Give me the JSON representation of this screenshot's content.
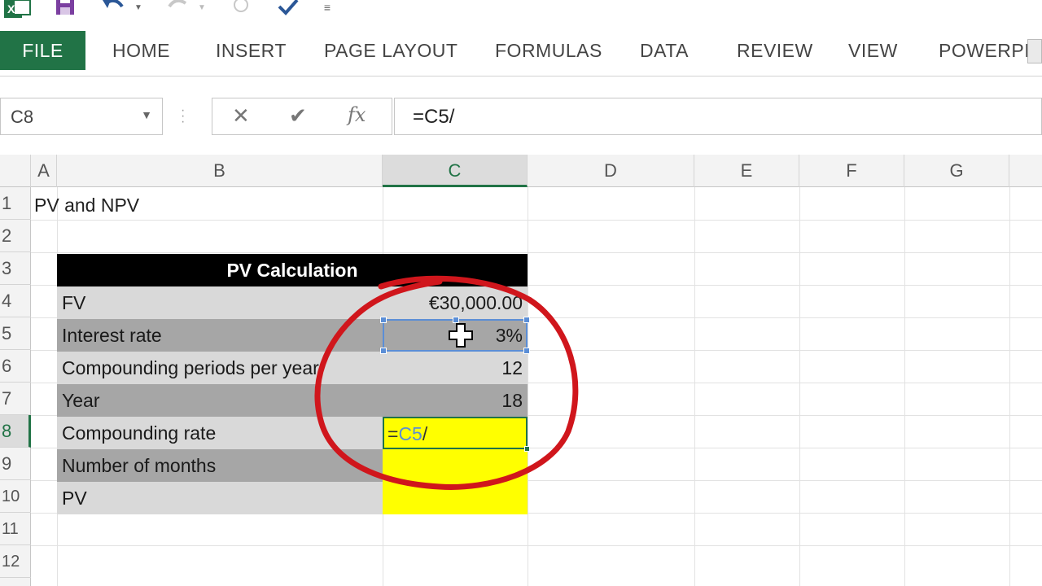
{
  "ribbon": {
    "tabs": [
      "FILE",
      "HOME",
      "INSERT",
      "PAGE LAYOUT",
      "FORMULAS",
      "DATA",
      "REVIEW",
      "VIEW",
      "POWERPIVO"
    ]
  },
  "formula_bar": {
    "name_box": "C8",
    "formula": "=C5/",
    "fx_label": "fx"
  },
  "columns": [
    "A",
    "B",
    "C",
    "D",
    "E",
    "F",
    "G"
  ],
  "rows": [
    "1",
    "2",
    "3",
    "4",
    "5",
    "6",
    "7",
    "8",
    "9",
    "10",
    "11",
    "12"
  ],
  "sheet": {
    "title": "PV and NPV",
    "table_header": "PV Calculation",
    "rows": [
      {
        "label": "FV",
        "value": "€30,000.00"
      },
      {
        "label": "Interest rate",
        "value": "3%"
      },
      {
        "label": "Compounding periods per year",
        "value": "12"
      },
      {
        "label": "Year",
        "value": "18"
      },
      {
        "label": "Compounding rate",
        "value": ""
      },
      {
        "label": "Number of months",
        "value": ""
      },
      {
        "label": "PV",
        "value": ""
      }
    ],
    "editing": {
      "eq": "=",
      "ref": "C5",
      "op": "/"
    }
  },
  "colors": {
    "excel_green": "#217346",
    "highlight_yellow": "#ffff00",
    "reference_blue": "#5b8ed6",
    "annotation_red": "#d0161c"
  }
}
